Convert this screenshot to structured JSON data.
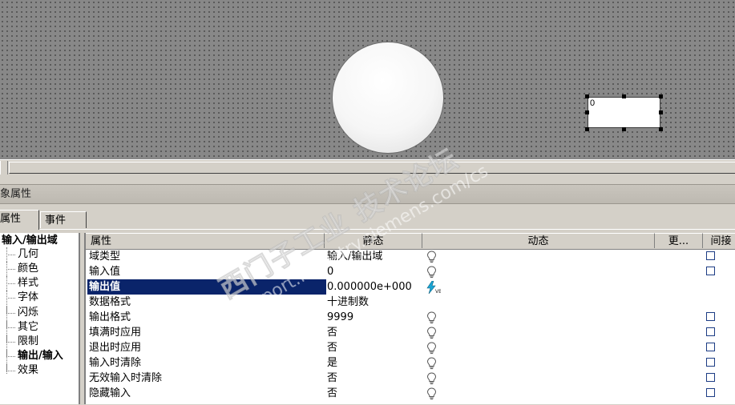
{
  "canvas": {
    "io_field_value": "0"
  },
  "panel": {
    "title": "象属性"
  },
  "tabs": [
    {
      "label": "属性"
    },
    {
      "label": "事件"
    }
  ],
  "tree": {
    "root": "输入/输出域",
    "items": [
      "几何",
      "颜色",
      "样式",
      "字体",
      "闪烁",
      "其它",
      "限制",
      "输出/输入",
      "效果"
    ],
    "selected": "输出/输入"
  },
  "table": {
    "headers": {
      "property": "属性",
      "static": "静态",
      "dynamic": "动态",
      "more": "更...",
      "indirect": "间接"
    },
    "rows": [
      {
        "name": "域类型",
        "value": "输入/输出域",
        "dynamic": "bulb",
        "indirect": true
      },
      {
        "name": "输入值",
        "value": "0",
        "dynamic": "bulb",
        "indirect": true
      },
      {
        "name": "输出值",
        "value": "0.000000e+000",
        "dynamic": "lightning",
        "indirect": false
      },
      {
        "name": "数据格式",
        "value": "十进制数",
        "dynamic": "none",
        "indirect": false
      },
      {
        "name": "输出格式",
        "value": "9999",
        "dynamic": "bulb",
        "indirect": true
      },
      {
        "name": "填满时应用",
        "value": "否",
        "dynamic": "bulb",
        "indirect": true
      },
      {
        "name": "退出时应用",
        "value": "否",
        "dynamic": "bulb",
        "indirect": true
      },
      {
        "name": "输入时清除",
        "value": "是",
        "dynamic": "bulb",
        "indirect": true
      },
      {
        "name": "无效输入时清除",
        "value": "否",
        "dynamic": "bulb",
        "indirect": true
      },
      {
        "name": "隐藏输入",
        "value": "否",
        "dynamic": "bulb",
        "indirect": true
      }
    ],
    "selected_row": 2
  },
  "watermark": {
    "line1": "西门子工业 技术论坛",
    "line2": "support.industry.siemens.com/cs"
  },
  "colors": {
    "selection": "#0a246a",
    "lightning": "#1aa6d6",
    "checkbox_border": "#1c3c84"
  }
}
